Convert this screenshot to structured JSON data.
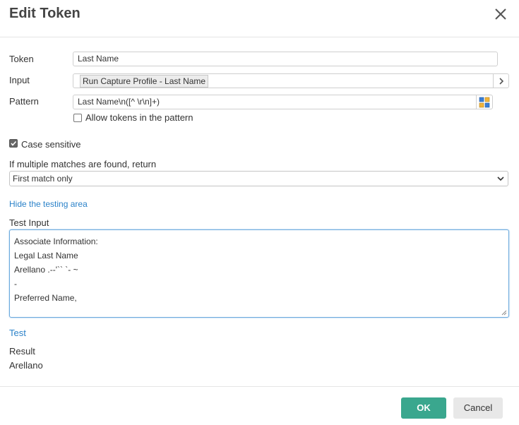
{
  "dialog": {
    "title": "Edit Token"
  },
  "token": {
    "label": "Token",
    "value": "Last Name"
  },
  "input": {
    "label": "Input",
    "chip": "Run Capture Profile - Last Name"
  },
  "pattern": {
    "label": "Pattern",
    "value": "Last Name\\n([^ \\r\\n]+)",
    "allow_tokens_label": "Allow tokens in the pattern",
    "allow_tokens_checked": false
  },
  "case_sensitive": {
    "label": "Case sensitive",
    "checked": true
  },
  "multiple": {
    "label": "If multiple matches are found, return",
    "selected": "First match only"
  },
  "testing": {
    "hide_link": "Hide the testing area",
    "test_input_label": "Test Input",
    "lines": [
      "Associate Information:",
      "Legal Last Name",
      "Arellano .--'`` `- ~",
      "-",
      "Preferred Name,"
    ],
    "test_link": "Test",
    "result_label": "Result",
    "result_value": "Arellano"
  },
  "footer": {
    "ok": "OK",
    "cancel": "Cancel"
  },
  "colors": {
    "accent": "#3aa78e",
    "link": "#2b82c9"
  }
}
